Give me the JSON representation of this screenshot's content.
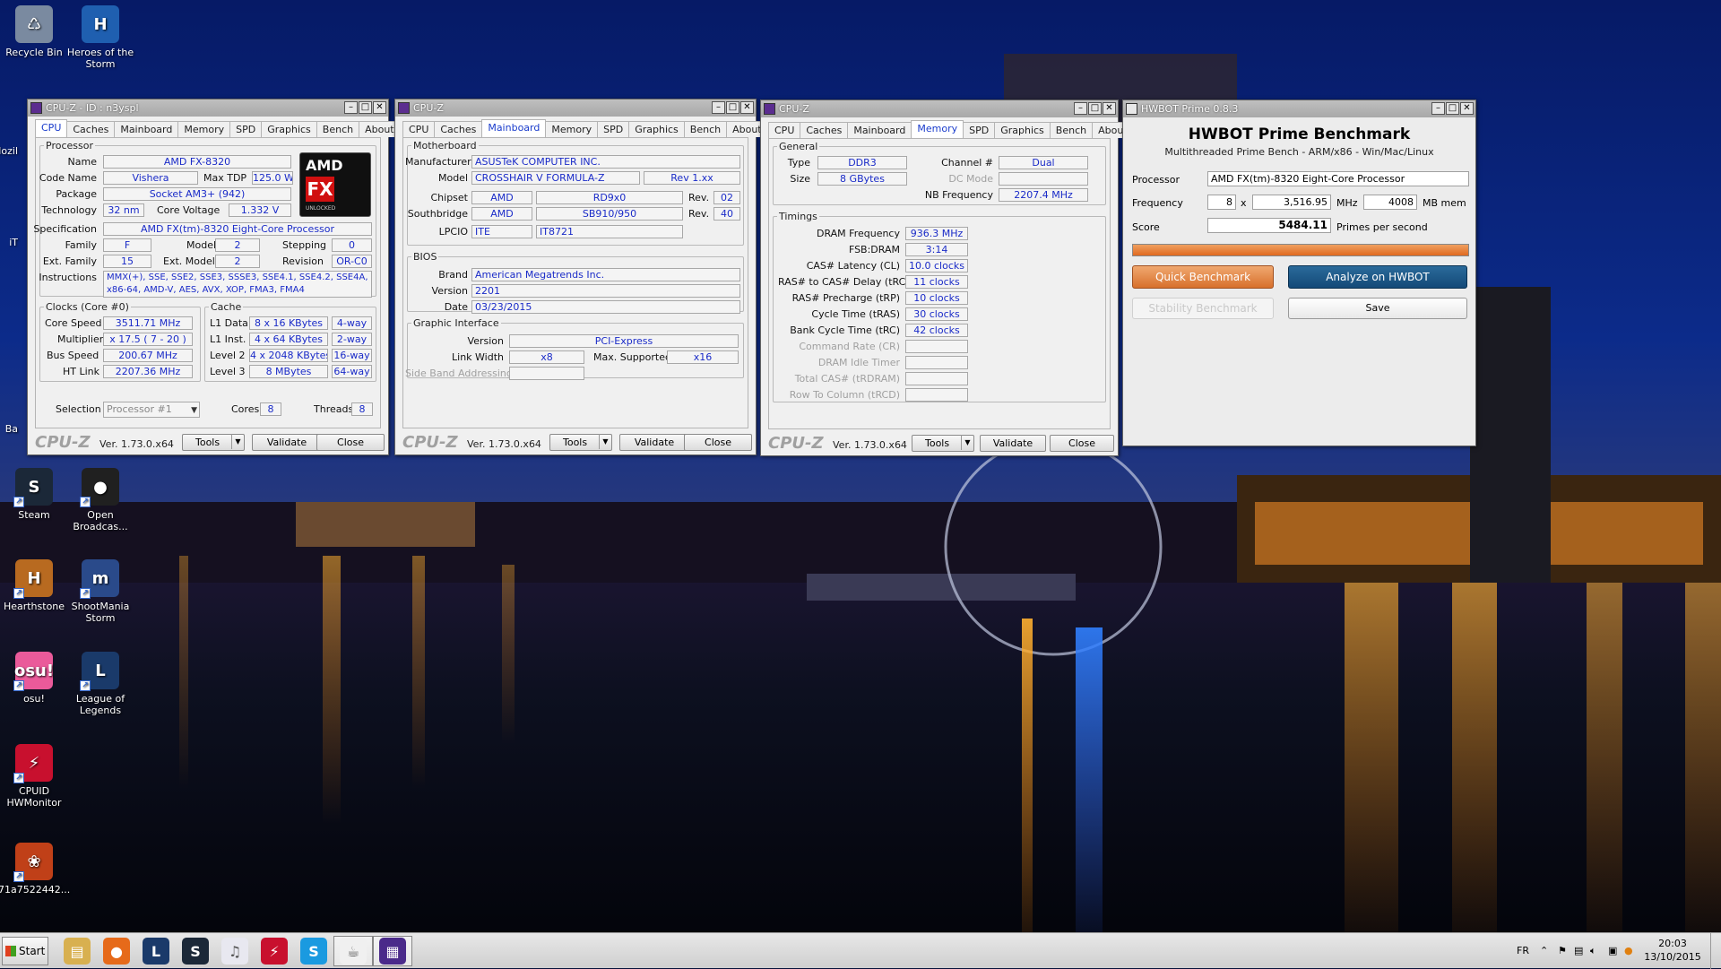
{
  "desktop": {
    "icons": [
      {
        "label": "Recycle Bin",
        "color": "#7a8aa0",
        "glyph": "♺",
        "icon": "recycle-bin-icon"
      },
      {
        "label": "Heroes of the Storm",
        "color": "#1f5fb0",
        "glyph": "H",
        "icon": "heroes-of-the-storm-icon"
      },
      {
        "label": "Steam",
        "color": "#1b2838",
        "glyph": "S",
        "icon": "steam-icon"
      },
      {
        "label": "Open Broadcas...",
        "color": "#202020",
        "glyph": "●",
        "icon": "obs-icon"
      },
      {
        "label": "Hearthstone",
        "color": "#b86a20",
        "glyph": "H",
        "icon": "hearthstone-icon"
      },
      {
        "label": "ShootMania Storm",
        "color": "#2a4a8a",
        "glyph": "m",
        "icon": "shootmania-icon"
      },
      {
        "label": "osu!",
        "color": "#ea5a9a",
        "glyph": "osu!",
        "icon": "osu-icon"
      },
      {
        "label": "League of Legends",
        "color": "#1a3a6a",
        "glyph": "L",
        "icon": "league-of-legends-icon"
      },
      {
        "label": "CPUID HWMonitor",
        "color": "#c8102e",
        "glyph": "⚡",
        "icon": "hwmonitor-icon"
      },
      {
        "label": "71a7522442...",
        "color": "#c04018",
        "glyph": "❀",
        "icon": "image-file-icon"
      }
    ],
    "edge_labels": [
      "Mozil",
      "iT",
      "Ba"
    ]
  },
  "cpuz1": {
    "title": "CPU-Z - ID : n3yspl",
    "tabs": [
      "CPU",
      "Caches",
      "Mainboard",
      "Memory",
      "SPD",
      "Graphics",
      "Bench",
      "About"
    ],
    "active_tab": "CPU",
    "processor": {
      "legend": "Processor",
      "name_l": "Name",
      "name": "AMD FX-8320",
      "code_l": "Code Name",
      "code": "Vishera",
      "tdp_l": "Max TDP",
      "tdp": "125.0 W",
      "pkg_l": "Package",
      "pkg": "Socket AM3+ (942)",
      "tech_l": "Technology",
      "tech": "32 nm",
      "volt_l": "Core Voltage",
      "volt": "1.332 V",
      "spec_l": "Specification",
      "spec": "AMD FX(tm)-8320 Eight-Core Processor",
      "fam_l": "Family",
      "fam": "F",
      "model_l": "Model",
      "model": "2",
      "step_l": "Stepping",
      "step": "0",
      "efam_l": "Ext. Family",
      "efam": "15",
      "emodel_l": "Ext. Model",
      "emodel": "2",
      "rev_l": "Revision",
      "rev": "OR-C0",
      "instr_l": "Instructions",
      "instr": "MMX(+), SSE, SSE2, SSE3, SSSE3, SSE4.1, SSE4.2, SSE4A, x86-64, AMD-V, AES, AVX, XOP, FMA3, FMA4",
      "logo_top": "AMD",
      "logo_mid": "FX",
      "logo_bot": "UNLOCKED"
    },
    "clocks": {
      "legend": "Clocks (Core #0)",
      "speed_l": "Core Speed",
      "speed": "3511.71 MHz",
      "mult_l": "Multiplier",
      "mult": "x 17.5 ( 7 - 20 )",
      "bus_l": "Bus Speed",
      "bus": "200.67 MHz",
      "ht_l": "HT Link",
      "ht": "2207.36 MHz"
    },
    "cache": {
      "legend": "Cache",
      "l1d_l": "L1 Data",
      "l1d": "8 x 16 KBytes",
      "l1d_w": "4-way",
      "l1i_l": "L1 Inst.",
      "l1i": "4 x 64 KBytes",
      "l1i_w": "2-way",
      "l2_l": "Level 2",
      "l2": "4 x 2048 KBytes",
      "l2_w": "16-way",
      "l3_l": "Level 3",
      "l3": "8 MBytes",
      "l3_w": "64-way"
    },
    "sel_l": "Selection",
    "sel": "Processor #1",
    "cores_l": "Cores",
    "cores": "8",
    "threads_l": "Threads",
    "threads": "8",
    "brand": "CPU-Z",
    "version": "Ver. 1.73.0.x64",
    "tools": "Tools",
    "validate": "Validate",
    "close": "Close"
  },
  "cpuz2": {
    "title": "CPU-Z",
    "tabs": [
      "CPU",
      "Caches",
      "Mainboard",
      "Memory",
      "SPD",
      "Graphics",
      "Bench",
      "About"
    ],
    "active_tab": "Mainboard",
    "mb": {
      "legend": "Motherboard",
      "man_l": "Manufacturer",
      "man": "ASUSTeK COMPUTER INC.",
      "model_l": "Model",
      "model": "CROSSHAIR V FORMULA-Z",
      "model_rev": "Rev 1.xx",
      "chip_l": "Chipset",
      "chip_a": "AMD",
      "chip_b": "RD9x0",
      "chip_rev_l": "Rev.",
      "chip_rev": "02",
      "sb_l": "Southbridge",
      "sb_a": "AMD",
      "sb_b": "SB910/950",
      "sb_rev_l": "Rev.",
      "sb_rev": "40",
      "lpc_l": "LPCIO",
      "lpc_a": "ITE",
      "lpc_b": "IT8721"
    },
    "bios": {
      "legend": "BIOS",
      "brand_l": "Brand",
      "brand": "American Megatrends Inc.",
      "ver_l": "Version",
      "ver": "2201",
      "date_l": "Date",
      "date": "03/23/2015"
    },
    "gi": {
      "legend": "Graphic Interface",
      "ver_l": "Version",
      "ver": "PCI-Express",
      "lw_l": "Link Width",
      "lw": "x8",
      "max_l": "Max. Supported",
      "max": "x16",
      "sba_l": "Side Band Addressing"
    },
    "brand": "CPU-Z",
    "version": "Ver. 1.73.0.x64",
    "tools": "Tools",
    "validate": "Validate",
    "close": "Close"
  },
  "cpuz3": {
    "title": "CPU-Z",
    "tabs": [
      "CPU",
      "Caches",
      "Mainboard",
      "Memory",
      "SPD",
      "Graphics",
      "Bench",
      "About"
    ],
    "active_tab": "Memory",
    "gen": {
      "legend": "General",
      "type_l": "Type",
      "type": "DDR3",
      "ch_l": "Channel #",
      "ch": "Dual",
      "size_l": "Size",
      "size": "8 GBytes",
      "dc_l": "DC Mode",
      "nb_l": "NB Frequency",
      "nb": "2207.4 MHz"
    },
    "tim": {
      "legend": "Timings",
      "rows": [
        {
          "l": "DRAM Frequency",
          "v": "936.3 MHz",
          "dim": false
        },
        {
          "l": "FSB:DRAM",
          "v": "3:14",
          "dim": false
        },
        {
          "l": "CAS# Latency (CL)",
          "v": "10.0 clocks",
          "dim": false
        },
        {
          "l": "RAS# to CAS# Delay (tRCD)",
          "v": "11 clocks",
          "dim": false
        },
        {
          "l": "RAS# Precharge (tRP)",
          "v": "10 clocks",
          "dim": false
        },
        {
          "l": "Cycle Time (tRAS)",
          "v": "30 clocks",
          "dim": false
        },
        {
          "l": "Bank Cycle Time (tRC)",
          "v": "42 clocks",
          "dim": false
        },
        {
          "l": "Command Rate (CR)",
          "v": "",
          "dim": true
        },
        {
          "l": "DRAM Idle Timer",
          "v": "",
          "dim": true
        },
        {
          "l": "Total CAS# (tRDRAM)",
          "v": "",
          "dim": true
        },
        {
          "l": "Row To Column (tRCD)",
          "v": "",
          "dim": true
        }
      ]
    },
    "brand": "CPU-Z",
    "version": "Ver. 1.73.0.x64",
    "tools": "Tools",
    "validate": "Validate",
    "close": "Close"
  },
  "hwbot": {
    "title": "HWBOT Prime 0.8.3",
    "heading": "HWBOT Prime Benchmark",
    "sub": "Multithreaded Prime Bench - ARM/x86 - Win/Mac/Linux",
    "proc_l": "Processor",
    "proc": "AMD FX(tm)-8320 Eight-Core Processor",
    "freq_l": "Frequency",
    "cores": "8",
    "x": "x",
    "freq": "3,516.95",
    "mhz": "MHz",
    "mem": "4008",
    "mem_l": "MB mem",
    "score_l": "Score",
    "score": "5484.11",
    "score_unit": "Primes per second",
    "progress": 1.0,
    "quick": "Quick Benchmark",
    "analyze": "Analyze on HWBOT",
    "stability": "Stability Benchmark",
    "save": "Save"
  },
  "taskbar": {
    "start": "Start",
    "lang": "FR",
    "time": "20:03",
    "date": "13/10/2015",
    "apps": [
      {
        "icon": "file-explorer-icon",
        "color": "#d8b050",
        "glyph": "▤"
      },
      {
        "icon": "firefox-icon",
        "color": "#e66a1a",
        "glyph": "●"
      },
      {
        "icon": "league-of-legends-icon",
        "color": "#1a3a6a",
        "glyph": "L"
      },
      {
        "icon": "steam-icon",
        "color": "#1b2838",
        "glyph": "S"
      },
      {
        "icon": "itunes-icon",
        "color": "#e8e8f0",
        "glyph": "♫"
      },
      {
        "icon": "hwmonitor-icon",
        "color": "#c8102e",
        "glyph": "⚡"
      },
      {
        "icon": "skype-icon",
        "color": "#1a9ae0",
        "glyph": "S"
      },
      {
        "icon": "java-icon",
        "color": "#f0f0f0",
        "glyph": "☕"
      },
      {
        "icon": "cpuz-icon",
        "color": "#4a2a8a",
        "glyph": "▦"
      }
    ]
  }
}
